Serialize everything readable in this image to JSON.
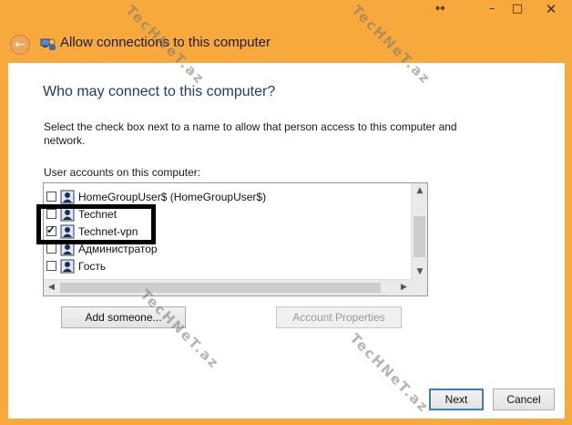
{
  "window": {
    "title": "Allow connections to this computer",
    "controls": {
      "minimize": "–",
      "maximize": "□",
      "close": "✕"
    },
    "resize_glyph": "↔"
  },
  "page": {
    "heading": "Who may connect to this computer?",
    "instructions": "Select the check box next to a name to allow that person access to this computer and network.",
    "list_label": "User accounts on this computer:"
  },
  "users": [
    {
      "name": "HomeGroupUser$ (HomeGroupUser$)",
      "checked": false
    },
    {
      "name": "Technet",
      "checked": false
    },
    {
      "name": "Technet-vpn",
      "checked": true
    },
    {
      "name": "Администратор",
      "checked": false
    },
    {
      "name": "Гость",
      "checked": false
    }
  ],
  "buttons": {
    "add_someone": "Add someone...",
    "account_properties": "Account Properties",
    "next": "Next",
    "cancel": "Cancel"
  },
  "watermark_text": "TecHNeT.az",
  "colors": {
    "frame": "#f7a93b",
    "heading": "#1e3a78",
    "highlight": "#000000"
  }
}
